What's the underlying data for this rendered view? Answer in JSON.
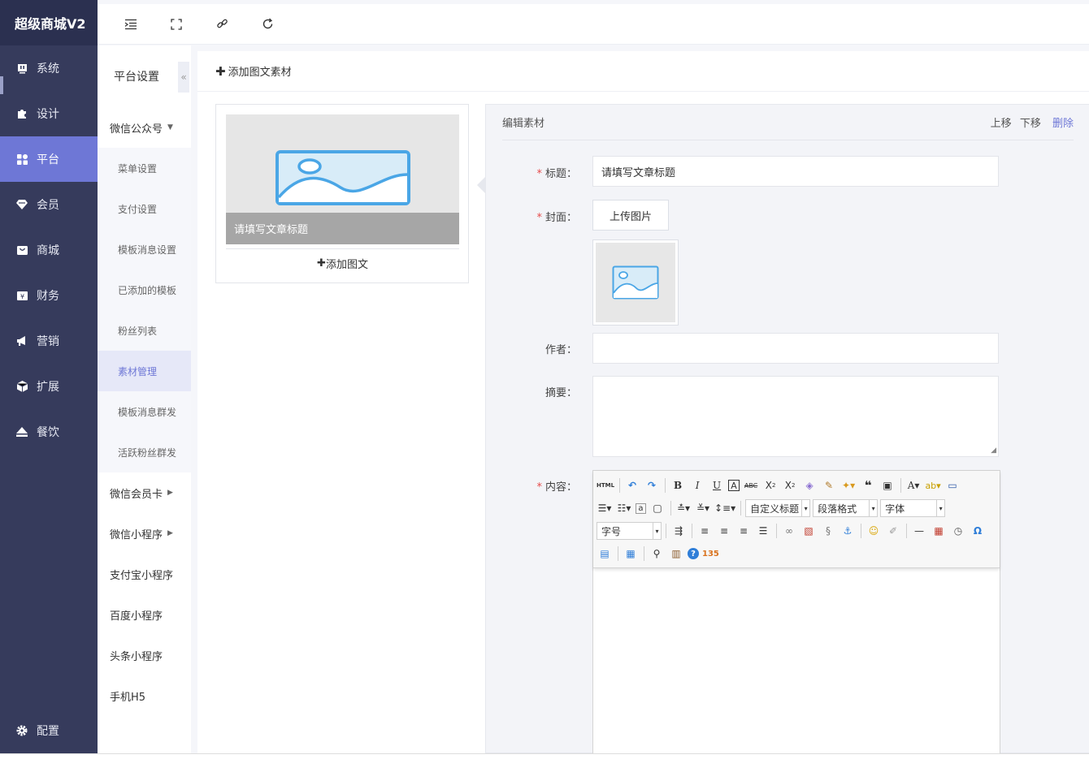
{
  "brand": "超级商城V2",
  "main_nav": [
    {
      "label": "系统",
      "icon": "system-icon"
    },
    {
      "label": "设计",
      "icon": "puzzle-icon"
    },
    {
      "label": "平台",
      "icon": "grid-icon"
    },
    {
      "label": "会员",
      "icon": "tag-icon"
    },
    {
      "label": "商城",
      "icon": "store-icon"
    },
    {
      "label": "财务",
      "icon": "yen-icon"
    },
    {
      "label": "营销",
      "icon": "megaphone-icon"
    },
    {
      "label": "扩展",
      "icon": "cube-icon"
    },
    {
      "label": "餐饮",
      "icon": "eject-icon"
    }
  ],
  "main_nav_bottom": {
    "label": "配置",
    "icon": "gear-icon"
  },
  "sub_sidebar": {
    "title": "平台设置",
    "collapse_icon": "«",
    "groups": [
      {
        "label": "微信公众号",
        "caret": "▼"
      },
      {
        "label": "微信会员卡",
        "caret": "▶"
      },
      {
        "label": "微信小程序",
        "caret": "▶"
      },
      {
        "label": "支付宝小程序"
      },
      {
        "label": "百度小程序"
      },
      {
        "label": "头条小程序"
      },
      {
        "label": "手机H5"
      }
    ],
    "wechat_items": [
      "菜单设置",
      "支付设置",
      "模板消息设置",
      "已添加的模板",
      "粉丝列表",
      "素材管理",
      "模板消息群发",
      "活跃粉丝群发"
    ]
  },
  "content": {
    "header": "添加图文素材",
    "preview": {
      "caption": "请填写文章标题",
      "add_label": "添加图文"
    },
    "editor": {
      "title": "编辑素材",
      "move_up": "上移",
      "move_down": "下移",
      "delete": "删除",
      "title_label": "标题：",
      "title_value": "请填写文章标题",
      "cover_label": "封面：",
      "upload_label": "上传图片",
      "author_label": "作者：",
      "summary_label": "摘要：",
      "content_label": "内容：",
      "required_mark": "*"
    },
    "ueditor": {
      "dd_custom_title": "自定义标题",
      "dd_paragraph": "段落格式",
      "dd_font": "字体",
      "dd_size": "字号",
      "html_label": "HTML"
    }
  },
  "colors": {
    "sidebar": "#363b5c",
    "brand_bg": "#2b3050",
    "accent": "#6e77d6",
    "required": "#e64c4c"
  }
}
